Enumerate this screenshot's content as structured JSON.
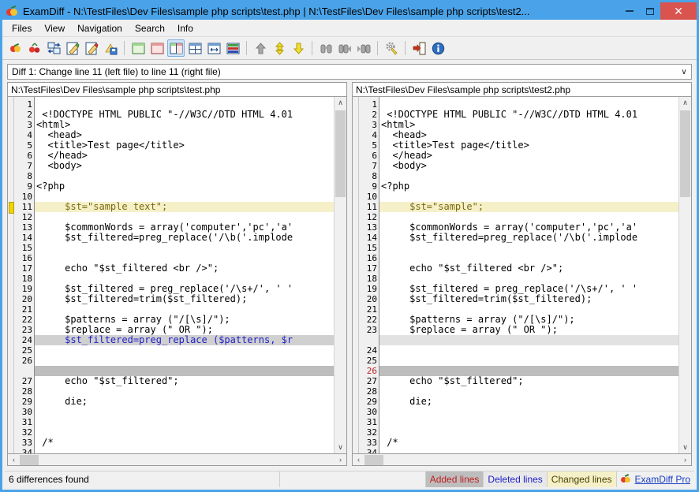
{
  "window": {
    "app_icon": "apple-icon",
    "title": "ExamDiff - N:\\TestFiles\\Dev Files\\sample php scripts\\test.php  |  N:\\TestFiles\\Dev Files\\sample php scripts\\test2...",
    "minimize_label": "–",
    "maximize_label": "□",
    "close_label": "✕"
  },
  "menubar": {
    "items": [
      {
        "label": "Files",
        "name": "menu-files"
      },
      {
        "label": "View",
        "name": "menu-view"
      },
      {
        "label": "Navigation",
        "name": "menu-navigation"
      },
      {
        "label": "Search",
        "name": "menu-search"
      },
      {
        "label": "Info",
        "name": "menu-info"
      }
    ]
  },
  "toolbar": {
    "buttons": [
      {
        "name": "compare-files-icon",
        "kind": "apple"
      },
      {
        "name": "compare-directories-icon",
        "kind": "cherry"
      },
      {
        "name": "swap-files-icon",
        "kind": "swap"
      },
      {
        "name": "edit-left-file-icon",
        "kind": "pencil-green"
      },
      {
        "name": "edit-right-file-icon",
        "kind": "pencil-red"
      },
      {
        "name": "save-file-icon",
        "kind": "save"
      },
      {
        "name": "sep1",
        "kind": "sep"
      },
      {
        "name": "view-left-only-icon",
        "kind": "pane-green"
      },
      {
        "name": "view-right-only-icon",
        "kind": "pane-red"
      },
      {
        "name": "view-side-by-side-icon",
        "kind": "pane-split",
        "active": true
      },
      {
        "name": "view-horizontal-split-icon",
        "kind": "pane-quad"
      },
      {
        "name": "view-sync-scroll-icon",
        "kind": "pane-arrows"
      },
      {
        "name": "view-unified-icon",
        "kind": "pane-stripes"
      },
      {
        "name": "sep2",
        "kind": "sep"
      },
      {
        "name": "previous-difference-icon",
        "kind": "arrow-up"
      },
      {
        "name": "next-difference-icon",
        "kind": "arrow-updown"
      },
      {
        "name": "last-difference-icon",
        "kind": "arrow-down"
      },
      {
        "name": "sep3",
        "kind": "sep"
      },
      {
        "name": "find-icon",
        "kind": "binoculars"
      },
      {
        "name": "find-next-icon",
        "kind": "binoculars-next"
      },
      {
        "name": "find-previous-icon",
        "kind": "binoculars-prev"
      },
      {
        "name": "sep4",
        "kind": "sep"
      },
      {
        "name": "options-icon",
        "kind": "gear"
      },
      {
        "name": "sep5",
        "kind": "sep"
      },
      {
        "name": "exit-icon",
        "kind": "exit"
      },
      {
        "name": "about-icon",
        "kind": "info"
      }
    ]
  },
  "diff_selector": {
    "value": "Diff 1: Change line 11 (left file) to line 11 (right file)",
    "arrow": "∨"
  },
  "left_pane": {
    "path": "N:\\TestFiles\\Dev Files\\sample php scripts\\test.php",
    "line_numbers": [
      "1",
      "2",
      "3",
      "4",
      "5",
      "6",
      "7",
      "8",
      "9",
      "10",
      "11",
      "12",
      "13",
      "14",
      "15",
      "16",
      "17",
      "18",
      "19",
      "20",
      "21",
      "22",
      "23",
      "24",
      "25",
      "26",
      "27",
      "28",
      "29",
      "30",
      "31",
      "32",
      "33",
      "34"
    ],
    "lines": [
      {
        "n": "1",
        "text": "",
        "style": "normal"
      },
      {
        "n": "2",
        "text": " <!DOCTYPE HTML PUBLIC \"-//W3C//DTD HTML 4.01",
        "style": "normal"
      },
      {
        "n": "3",
        "text": "<html>",
        "style": "normal"
      },
      {
        "n": "4",
        "text": "  <head>",
        "style": "normal"
      },
      {
        "n": "5",
        "text": "  <title>Test page</title>",
        "style": "normal"
      },
      {
        "n": "6",
        "text": "  </head>",
        "style": "normal"
      },
      {
        "n": "7",
        "text": "  <body>",
        "style": "normal"
      },
      {
        "n": "8",
        "text": "",
        "style": "normal"
      },
      {
        "n": "9",
        "text": "<?php",
        "style": "normal"
      },
      {
        "n": "10",
        "text": "",
        "style": "normal"
      },
      {
        "n": "11",
        "text": "     $st=\"sample text\";",
        "style": "changed"
      },
      {
        "n": "12",
        "text": "",
        "style": "normal"
      },
      {
        "n": "13",
        "text": "     $commonWords = array('computer','pc','a'",
        "style": "normal"
      },
      {
        "n": "14",
        "text": "     $st_filtered=preg_replace('/\\b('.implode",
        "style": "normal"
      },
      {
        "n": "15",
        "text": "",
        "style": "normal"
      },
      {
        "n": "16",
        "text": "",
        "style": "normal"
      },
      {
        "n": "17",
        "text": "     echo \"$st_filtered <br />\";",
        "style": "normal"
      },
      {
        "n": "18",
        "text": "",
        "style": "normal"
      },
      {
        "n": "19",
        "text": "     $st_filtered = preg_replace('/\\s+/', ' '",
        "style": "normal"
      },
      {
        "n": "20",
        "text": "     $st_filtered=trim($st_filtered);",
        "style": "normal"
      },
      {
        "n": "21",
        "text": "",
        "style": "normal"
      },
      {
        "n": "22",
        "text": "     $patterns = array (\"/[\\s]/\");",
        "style": "normal"
      },
      {
        "n": "23",
        "text": "     $replace = array (\" OR \");",
        "style": "normal"
      },
      {
        "n": "24",
        "text": "     $st_filtered=preg_replace ($patterns, $r",
        "style": "curchange"
      },
      {
        "n": "25",
        "text": "",
        "style": "normal"
      },
      {
        "n": "26",
        "text": "",
        "style": "normal"
      },
      {
        "n": "",
        "text": "",
        "style": "filler"
      },
      {
        "n": "27",
        "text": "     echo \"$st_filtered\";",
        "style": "normal"
      },
      {
        "n": "28",
        "text": "",
        "style": "normal"
      },
      {
        "n": "29",
        "text": "     die;",
        "style": "normal"
      },
      {
        "n": "30",
        "text": "",
        "style": "normal"
      },
      {
        "n": "31",
        "text": "",
        "style": "normal"
      },
      {
        "n": "32",
        "text": "",
        "style": "normal"
      },
      {
        "n": "33",
        "text": " /*",
        "style": "normal"
      },
      {
        "n": "34",
        "text": "",
        "style": "normal"
      }
    ],
    "scroll_up_arrow": "∧",
    "scroll_down_arrow": "∨",
    "scroll_left_arrow": "‹",
    "scroll_right_arrow": "›"
  },
  "right_pane": {
    "path": "N:\\TestFiles\\Dev Files\\sample php scripts\\test2.php",
    "lines": [
      {
        "n": "1",
        "text": "",
        "style": "normal"
      },
      {
        "n": "2",
        "text": " <!DOCTYPE HTML PUBLIC \"-//W3C//DTD HTML 4.01",
        "style": "normal"
      },
      {
        "n": "3",
        "text": "<html>",
        "style": "normal"
      },
      {
        "n": "4",
        "text": "  <head>",
        "style": "normal"
      },
      {
        "n": "5",
        "text": "  <title>Test page</title>",
        "style": "normal"
      },
      {
        "n": "6",
        "text": "  </head>",
        "style": "normal"
      },
      {
        "n": "7",
        "text": "  <body>",
        "style": "normal"
      },
      {
        "n": "8",
        "text": "",
        "style": "normal"
      },
      {
        "n": "9",
        "text": "<?php",
        "style": "normal"
      },
      {
        "n": "10",
        "text": "",
        "style": "normal"
      },
      {
        "n": "11",
        "text": "     $st=\"sample\";",
        "style": "changed"
      },
      {
        "n": "12",
        "text": "",
        "style": "normal"
      },
      {
        "n": "13",
        "text": "     $commonWords = array('computer','pc','a'",
        "style": "normal"
      },
      {
        "n": "14",
        "text": "     $st_filtered=preg_replace('/\\b('.implode",
        "style": "normal"
      },
      {
        "n": "15",
        "text": "",
        "style": "normal"
      },
      {
        "n": "16",
        "text": "",
        "style": "normal"
      },
      {
        "n": "17",
        "text": "     echo \"$st_filtered <br />\";",
        "style": "normal"
      },
      {
        "n": "18",
        "text": "",
        "style": "normal"
      },
      {
        "n": "19",
        "text": "     $st_filtered = preg_replace('/\\s+/', ' '",
        "style": "normal"
      },
      {
        "n": "20",
        "text": "     $st_filtered=trim($st_filtered);",
        "style": "normal"
      },
      {
        "n": "21",
        "text": "",
        "style": "normal"
      },
      {
        "n": "22",
        "text": "     $patterns = array (\"/[\\s]/\");",
        "style": "normal"
      },
      {
        "n": "23",
        "text": "     $replace = array (\" OR \");",
        "style": "normal"
      },
      {
        "n": "",
        "text": "",
        "style": "filler-light"
      },
      {
        "n": "24",
        "text": "",
        "style": "normal"
      },
      {
        "n": "25",
        "text": "",
        "style": "normal"
      },
      {
        "n": "26",
        "text": "",
        "style": "filler",
        "redno": true
      },
      {
        "n": "27",
        "text": "     echo \"$st_filtered\";",
        "style": "normal"
      },
      {
        "n": "28",
        "text": "",
        "style": "normal"
      },
      {
        "n": "29",
        "text": "     die;",
        "style": "normal"
      },
      {
        "n": "30",
        "text": "",
        "style": "normal"
      },
      {
        "n": "31",
        "text": "",
        "style": "normal"
      },
      {
        "n": "32",
        "text": "",
        "style": "normal"
      },
      {
        "n": "33",
        "text": " /*",
        "style": "normal"
      },
      {
        "n": "34",
        "text": "",
        "style": "normal"
      }
    ],
    "scroll_up_arrow": "∧",
    "scroll_down_arrow": "∨",
    "scroll_left_arrow": "‹",
    "scroll_right_arrow": "›"
  },
  "statusbar": {
    "differences": "6 differences found",
    "blank": "",
    "added_label": "Added lines",
    "deleted_label": "Deleted lines",
    "changed_label": "Changed lines",
    "brand": "ExamDiff Pro"
  },
  "colors": {
    "title_bar": "#4aa3e8",
    "close_button": "#d9534f",
    "changed_line_bg": "#f5f0c8",
    "current_change_bg": "#d0d0d0",
    "current_change_fg": "#2020c8",
    "filler_bg": "#bdbdbd",
    "added_text": "#c02020",
    "deleted_text": "#2020c8",
    "link": "#1a3fc4"
  }
}
